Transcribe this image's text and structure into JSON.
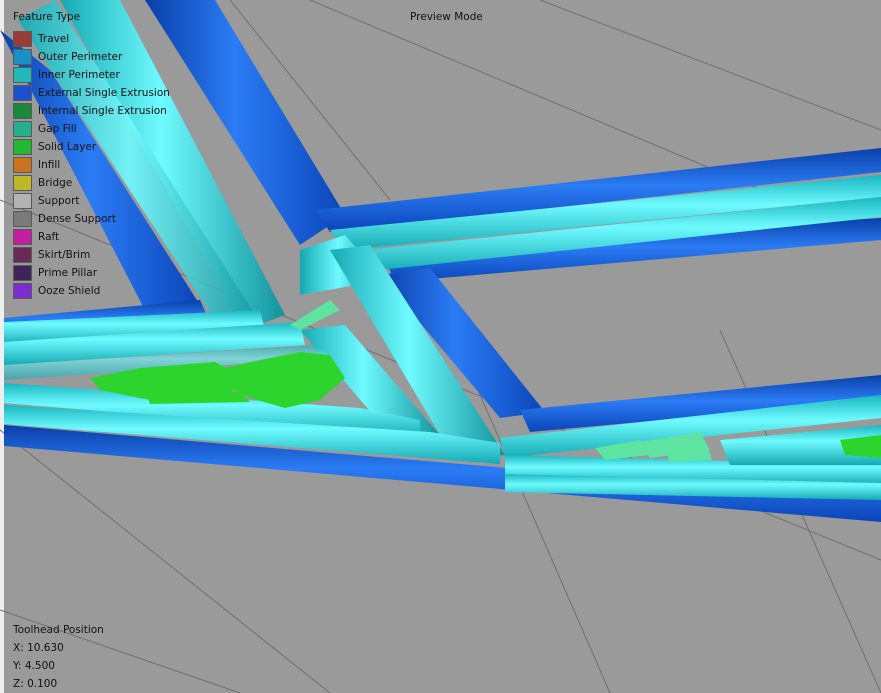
{
  "header": {
    "legend_title": "Feature Type",
    "mode": "Preview Mode"
  },
  "legend": [
    {
      "label": "Travel",
      "color": "#9b3a3a"
    },
    {
      "label": "Outer Perimeter",
      "color": "#1a8fc6"
    },
    {
      "label": "Inner Perimeter",
      "color": "#22b8b8"
    },
    {
      "label": "External Single Extrusion",
      "color": "#1d4fd1"
    },
    {
      "label": "Internal Single Extrusion",
      "color": "#1a8a3a"
    },
    {
      "label": "Gap Fill",
      "color": "#23b08a"
    },
    {
      "label": "Solid Layer",
      "color": "#22b833"
    },
    {
      "label": "Infill",
      "color": "#c8741e"
    },
    {
      "label": "Bridge",
      "color": "#bdb82a"
    },
    {
      "label": "Support",
      "color": "#b3b3b3"
    },
    {
      "label": "Dense Support",
      "color": "#7a7a7a"
    },
    {
      "label": "Raft",
      "color": "#c21fa0"
    },
    {
      "label": "Skirt/Brim",
      "color": "#6a2a56"
    },
    {
      "label": "Prime Pillar",
      "color": "#3f2458"
    },
    {
      "label": "Ooze Shield",
      "color": "#7a2ed0"
    }
  ],
  "toolhead": {
    "title": "Toolhead Position",
    "x": "X: 10.630",
    "y": "Y: 4.500",
    "z": "Z: 0.100"
  },
  "colors": {
    "background": "#9a9a9a",
    "grid": "#6f6f6f",
    "outer_perimeter": "#1566d8",
    "inner_perimeter": "#33eeee",
    "gap_fill": "#5ee3a0",
    "solid_layer": "#2ed42e"
  }
}
